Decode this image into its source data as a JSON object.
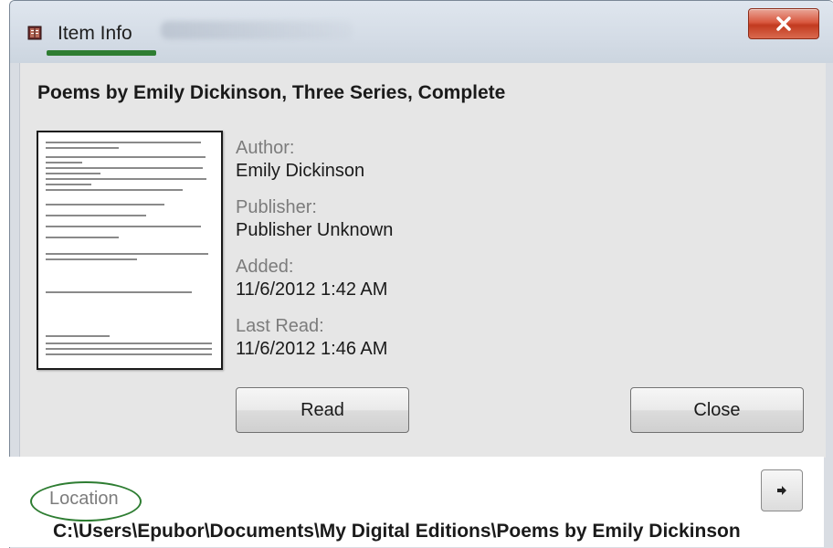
{
  "window": {
    "title": "Item Info"
  },
  "book": {
    "title": "Poems by Emily Dickinson, Three Series, Complete",
    "cover_icon": "book-cover-thumbnail"
  },
  "metadata": [
    {
      "label": "Author:",
      "value": "Emily Dickinson"
    },
    {
      "label": "Publisher:",
      "value": "Publisher Unknown"
    },
    {
      "label": "Added:",
      "value": "11/6/2012 1:42 AM"
    },
    {
      "label": "Last Read:",
      "value": "11/6/2012 1:46 AM"
    }
  ],
  "buttons": {
    "read": "Read",
    "close": "Close"
  },
  "location": {
    "label": "Location",
    "path": "C:\\Users\\Epubor\\Documents\\My Digital Editions\\Poems by Emily Dickinson"
  },
  "icons": {
    "app": "book-app-icon",
    "window_close": "close-x-icon",
    "open_folder": "arrow-right-icon"
  },
  "colors": {
    "highlight_green": "#2e7d32",
    "close_red": "#c23a1f"
  }
}
